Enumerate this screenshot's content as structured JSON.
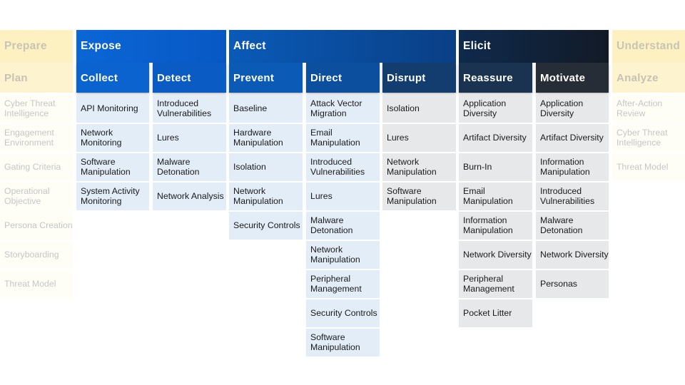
{
  "goals": [
    {
      "label": "Prepare"
    },
    {
      "label": "Expose"
    },
    {
      "label": "Affect"
    },
    {
      "label": "Elicit"
    },
    {
      "label": "Understand"
    }
  ],
  "activities": [
    {
      "label": "Plan",
      "items": [
        "Cyber Threat Intelligence",
        "Engagement Environment",
        "Gating Criteria",
        "Operational Objective",
        "Persona Creation",
        "Storyboarding",
        "Threat Model"
      ]
    },
    {
      "label": "Collect",
      "items": [
        "API Monitoring",
        "Network Monitoring",
        "Software Manipulation",
        "System Activity Monitoring"
      ]
    },
    {
      "label": "Detect",
      "items": [
        "Introduced Vulnerabilities",
        "Lures",
        "Malware Detonation",
        "Network Analysis"
      ]
    },
    {
      "label": "Prevent",
      "items": [
        "Baseline",
        "Hardware Manipulation",
        "Isolation",
        "Network Manipulation",
        "Security Controls"
      ]
    },
    {
      "label": "Direct",
      "items": [
        "Attack Vector Migration",
        "Email Manipulation",
        "Introduced Vulnerabilities",
        "Lures",
        "Malware Detonation",
        "Network Manipulation",
        "Peripheral Management",
        "Security Controls",
        "Software Manipulation"
      ]
    },
    {
      "label": "Disrupt",
      "items": [
        "Isolation",
        "Lures",
        "Network Manipulation",
        "Software Manipulation"
      ]
    },
    {
      "label": "Reassure",
      "items": [
        "Application Diversity",
        "Artifact Diversity",
        "Burn-In",
        "Email Manipulation",
        "Information Manipulation",
        "Network Diversity",
        "Peripheral Management",
        "Pocket Litter"
      ]
    },
    {
      "label": "Motivate",
      "items": [
        "Application Diversity",
        "Artifact Diversity",
        "Information Manipulation",
        "Introduced Vulnerabilities",
        "Malware Detonation",
        "Network Diversity",
        "Personas"
      ]
    },
    {
      "label": "Analyze",
      "items": [
        "After-Action Review",
        "Cyber Threat Intelligence",
        "Threat Model"
      ]
    }
  ],
  "colors": {
    "expose": "#0a5fcf",
    "affect": "#0b4a9a",
    "elicit": "#0f1f36",
    "faded": "#fdf1c2"
  }
}
